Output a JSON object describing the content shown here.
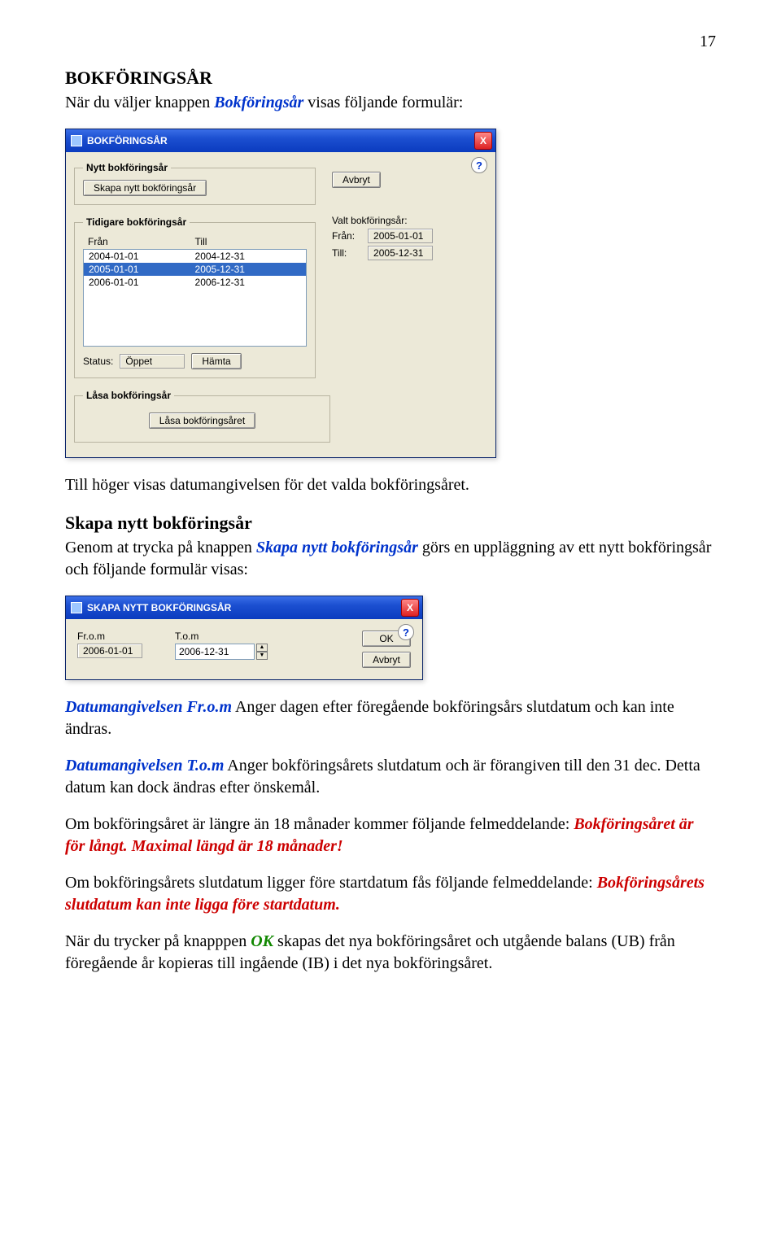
{
  "page_number": "17",
  "heading1": "BOKFÖRINGSÅR",
  "intro_pre": "När du väljer knappen ",
  "intro_btn": "Bokföringsår",
  "intro_post": " visas följande formulär:",
  "dialog1": {
    "title": "BOKFÖRINGSÅR",
    "help": "?",
    "close": "X",
    "group_new": "Nytt bokföringsår",
    "btn_create": "Skapa nytt bokföringsår",
    "btn_cancel": "Avbryt",
    "selected_header": "Valt bokföringsår:",
    "from_label": "Från:",
    "to_label": "Till:",
    "from_value": "2005-01-01",
    "to_value": "2005-12-31",
    "group_prev": "Tidigare bokföringsår",
    "col_from": "Från",
    "col_to": "Till",
    "rows": [
      {
        "from": "2004-01-01",
        "to": "2004-12-31",
        "selected": false
      },
      {
        "from": "2005-01-01",
        "to": "2005-12-31",
        "selected": true
      },
      {
        "from": "2006-01-01",
        "to": "2006-12-31",
        "selected": false
      }
    ],
    "status_label": "Status:",
    "status_value": "Öppet",
    "btn_fetch": "Hämta",
    "group_lock": "Låsa bokföringsår",
    "btn_lock": "Låsa bokföringsåret"
  },
  "p_after_dlg1": "Till höger visas datumangivelsen för det valda bokföringsåret.",
  "heading2": "Skapa nytt bokföringsår",
  "p2_pre": "Genom at trycka på knappen ",
  "p2_btn": "Skapa nytt bokföringsår",
  "p2_post": " görs en uppläggning av ett nytt bokföringsår och följande formulär visas:",
  "dialog2": {
    "title": "SKAPA NYTT BOKFÖRINGSÅR",
    "help": "?",
    "close": "X",
    "lbl_from": "Fr.o.m",
    "lbl_to": "T.o.m",
    "val_from": "2006-01-01",
    "val_to": "2006-12-31",
    "btn_ok": "OK",
    "btn_cancel": "Avbryt"
  },
  "p3_label": "Datumangivelsen Fr.o.m",
  "p3_text": " Anger dagen efter föregående bokföringsårs slutdatum och kan inte ändras.",
  "p4_label": "Datumangivelsen T.o.m",
  "p4_text": " Anger bokföringsårets slutdatum och är förangiven till den 31 dec. Detta datum kan dock ändras efter önskemål.",
  "p5_pre": "Om bokföringsåret är längre än 18 månader kommer följande felmeddelande: ",
  "p5_err": "Bokföringsåret är för långt. Maximal längd är 18 månader!",
  "p6_pre": "Om bokföringsårets slutdatum ligger före startdatum fås följande felmeddelande: ",
  "p6_err": "Bokföringsårets slutdatum kan inte ligga före startdatum.",
  "p7_pre": "När du trycker på knapppen ",
  "p7_btn": "OK",
  "p7_post": " skapas det nya bokföringsåret och utgående balans (UB) från föregående år kopieras till ingående (IB) i det nya bokföringsåret."
}
